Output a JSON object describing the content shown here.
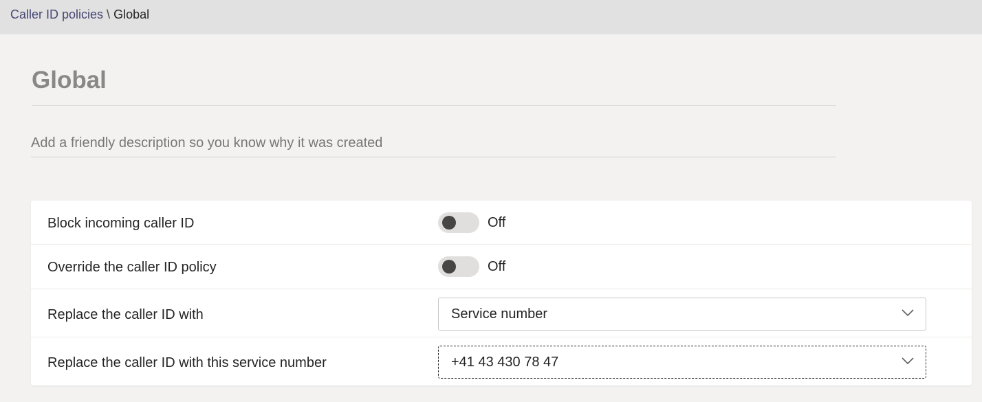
{
  "breadcrumb": {
    "parent": "Caller ID policies",
    "separator": "\\",
    "current": "Global"
  },
  "page": {
    "title": "Global",
    "description_placeholder": "Add a friendly description so you know why it was created",
    "description_value": ""
  },
  "settings": {
    "block_incoming": {
      "label": "Block incoming caller ID",
      "state": "Off"
    },
    "override_policy": {
      "label": "Override the caller ID policy",
      "state": "Off"
    },
    "replace_with": {
      "label": "Replace the caller ID with",
      "selected": "Service number"
    },
    "service_number": {
      "label": "Replace the caller ID with this service number",
      "selected": "+41 43 430 78 47"
    }
  },
  "icons": {
    "dropdown_chevron": "chevron-down-icon"
  },
  "colors": {
    "breadcrumb_link": "#464775",
    "toggle_off_track": "#e1dfdd",
    "toggle_off_knob": "#484644",
    "page_background": "#f3f2f1"
  }
}
